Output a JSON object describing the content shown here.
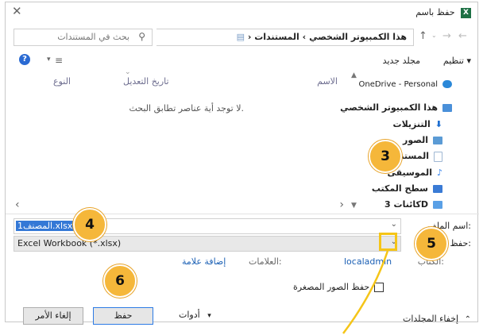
{
  "window": {
    "title": "حفظ باسم"
  },
  "nav": {
    "breadcrumb_pc": "هذا الكمبيوتر الشخصي",
    "breadcrumb_docs": "المستندات",
    "search_placeholder": "بحث في المستندات"
  },
  "toolbar": {
    "organize": "تنظيم ▾",
    "new_folder": "مجلد جديد"
  },
  "columns": {
    "name": "الاسم",
    "date": "تاريخ التعديل",
    "type": "النوع"
  },
  "empty_message": "لا توجد أية عناصر تطابق البحث.",
  "sidebar": {
    "items": [
      {
        "label": "OneDrive - Personal",
        "color": "#2b88d8"
      },
      {
        "label": "هذا الكمبيوتر الشخصي",
        "color": "#4a90d9"
      },
      {
        "label": "التنزيلات",
        "color": "#1f6fd1"
      },
      {
        "label": "الصور",
        "color": "#5b9bd5"
      },
      {
        "label": "المستندات",
        "color": "#9fb7d3"
      },
      {
        "label": "الموسيقى",
        "color": "#2f80ed"
      },
      {
        "label": "سطح المكتب",
        "color": "#3a7bd5"
      },
      {
        "label": "كائنات 3D",
        "color": "#5aa0e6"
      }
    ]
  },
  "form": {
    "filename_label": "اسم الملف:",
    "filename_value": "المصنف1.xlsx",
    "filetype_label": "حفظ بنوع:",
    "filetype_value": "Excel Workbook (*.xlsx)",
    "authors_label": "الكتاب:",
    "authors_value": "localadmin",
    "tags_label": "العلامات:",
    "tags_value": "إضافة علامة",
    "thumbnail_label": "حفظ الصور المصغرة"
  },
  "footer": {
    "hide_folders": "إخفاء المجلدات",
    "tools": "أدوات",
    "save": "حفظ",
    "cancel": "إلغاء الأمر"
  },
  "callouts": [
    "3",
    "4",
    "5",
    "6"
  ],
  "accent": "#f5b73a"
}
